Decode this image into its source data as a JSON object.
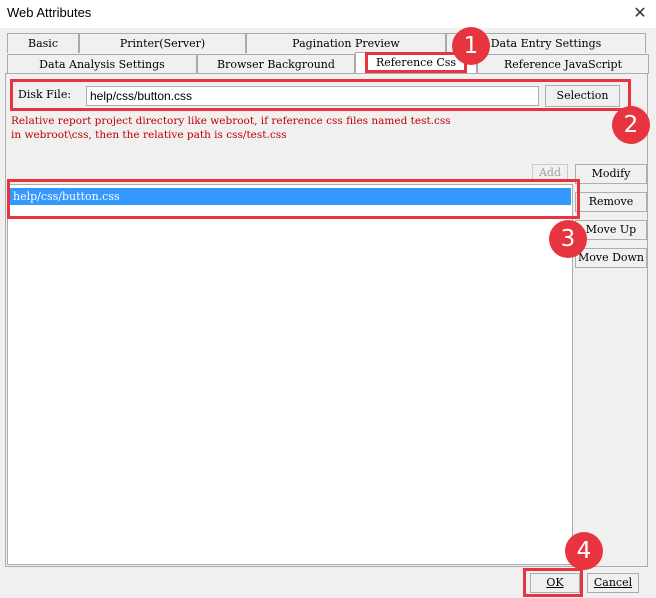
{
  "window": {
    "title": "Web Attributes",
    "close_glyph": "✕"
  },
  "tabs": {
    "row1": [
      "Basic",
      "Printer(Server)",
      "Pagination Preview",
      "Data Entry Settings"
    ],
    "row2": [
      "Data Analysis Settings",
      "Browser Background",
      "Reference Css",
      "Reference JavaScript"
    ],
    "active": "Reference Css"
  },
  "disk_file": {
    "label": "Disk File:",
    "value": "help/css/button.css",
    "selection_button": "Selection"
  },
  "hint": "Relative report project directory like webroot, if reference css files named test.css\nin webroot\\css, then the relative path is css/test.css",
  "actions": {
    "add": "Add",
    "modify": "Modify",
    "remove": "Remove",
    "move_up": "Move Up",
    "move_down": "Move Down"
  },
  "list": {
    "items": [
      "help/css/button.css"
    ]
  },
  "footer": {
    "ok": "OK",
    "cancel": "Cancel"
  },
  "annotations": [
    "1",
    "2",
    "3",
    "4"
  ],
  "colors": {
    "annotation": "#e8343f",
    "selection": "#3399ff",
    "hint_text": "#c00000"
  }
}
